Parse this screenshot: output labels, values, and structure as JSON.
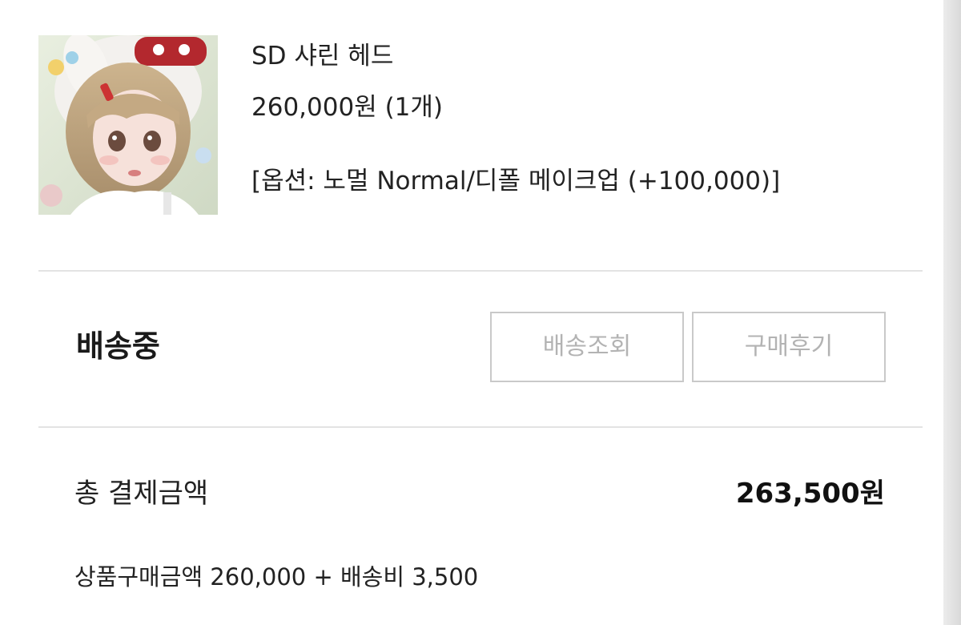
{
  "product": {
    "name": "SD 샤린 헤드",
    "price": "260,000원 (1개)",
    "option": "[옵션: 노멀 Normal/디폴 메이크업 (+100,000)]",
    "thumbnail_icon": "doll-photo"
  },
  "order": {
    "status": "배송중",
    "buttons": {
      "track_label": "배송조회",
      "review_label": "구매후기"
    }
  },
  "payment": {
    "total_label": "총 결제금액",
    "total_amount": "263,500원",
    "breakdown": "상품구매금액 260,000 + 배송비 3,500"
  },
  "colors": {
    "button_border": "#c9c9c9",
    "button_text": "#b3b3b3",
    "divider": "#e3e3e3"
  }
}
